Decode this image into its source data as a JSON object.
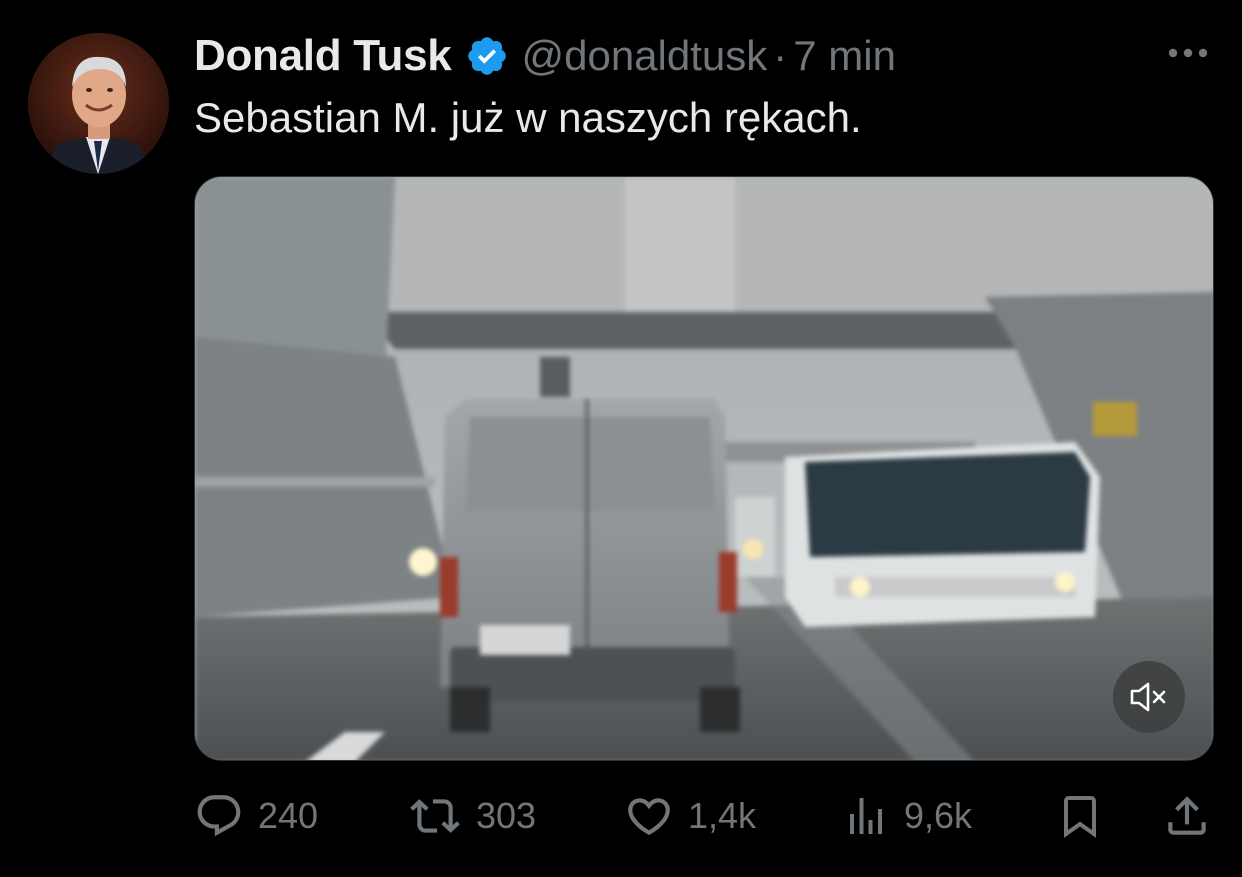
{
  "author": {
    "name": "Donald Tusk",
    "handle": "@donaldtusk",
    "separator": "·",
    "time": "7 min",
    "verified_color": "#1d9bf0"
  },
  "post": {
    "text": "Sebastian M. już w naszych rękach."
  },
  "media": {
    "type": "video",
    "mute_icon": "speaker-muted-icon"
  },
  "actions": {
    "replies": "240",
    "reposts": "303",
    "likes": "1,4k",
    "views": "9,6k"
  },
  "colors": {
    "background": "#000000",
    "text": "#e7e9ea",
    "secondary": "#71767b"
  }
}
